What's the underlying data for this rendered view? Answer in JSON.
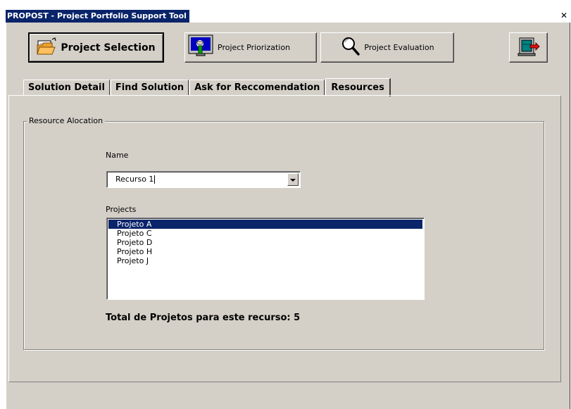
{
  "window": {
    "title": "PROPOST - Project Portfolio Support Tool",
    "close_glyph": "✕"
  },
  "toolbar": {
    "project_selection": {
      "label": "Project Selection",
      "icon": "folder-open-icon"
    },
    "project_priorization": {
      "label": "Project Priorization",
      "icon": "monitor-hand-icon"
    },
    "project_evaluation": {
      "label": "Project Evaluation",
      "icon": "magnifier-icon"
    },
    "exit": {
      "icon": "exit-door-icon"
    }
  },
  "tabs": [
    {
      "label": "Solution Detail",
      "active": false
    },
    {
      "label": "Find Solution",
      "active": false
    },
    {
      "label": "Ask for Reccomendation",
      "active": false
    },
    {
      "label": "Resources",
      "active": true
    }
  ],
  "resources": {
    "group_title": "Resource Alocation",
    "name_label": "Name",
    "name_value": "Recurso 1",
    "projects_label": "Projects",
    "projects": [
      {
        "label": "Projeto A",
        "selected": true
      },
      {
        "label": "Projeto C",
        "selected": false
      },
      {
        "label": "Projeto D",
        "selected": false
      },
      {
        "label": "Projeto H",
        "selected": false
      },
      {
        "label": "Projeto J",
        "selected": false
      }
    ],
    "total_text": "Total de Projetos para este recurso: 5"
  },
  "colors": {
    "window_bg": "#d4d0c8",
    "title_bg": "#0a246a",
    "selection_bg": "#0a246a"
  }
}
